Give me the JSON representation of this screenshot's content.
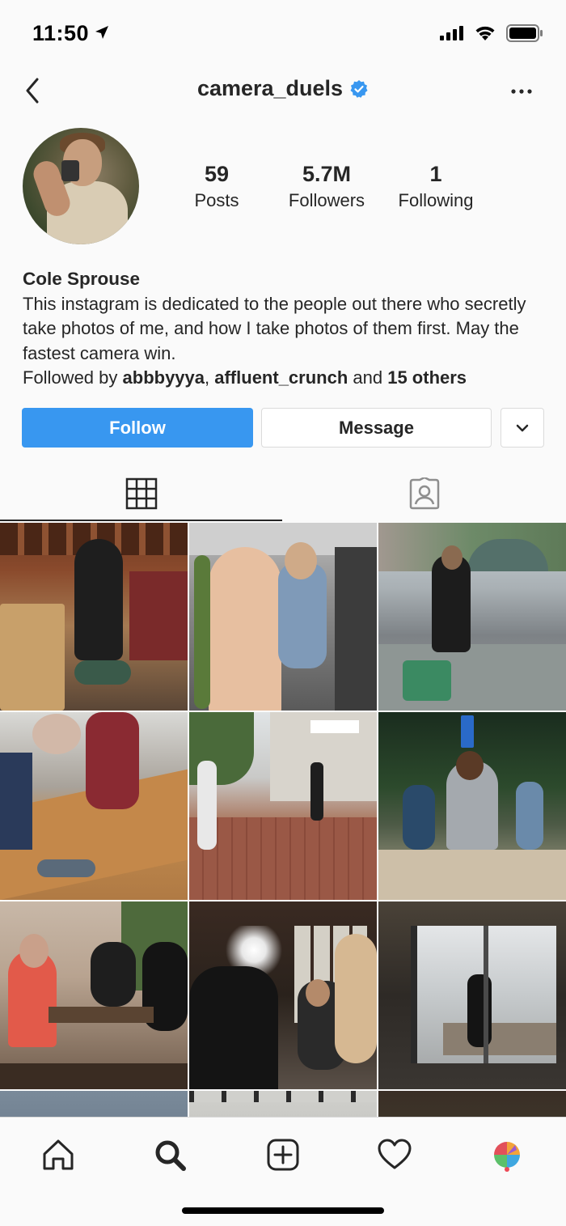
{
  "status_bar": {
    "time": "11:50"
  },
  "header": {
    "username": "camera_duels",
    "verified": true
  },
  "profile": {
    "stats": [
      {
        "value": "59",
        "label": "Posts"
      },
      {
        "value": "5.7M",
        "label": "Followers"
      },
      {
        "value": "1",
        "label": "Following"
      }
    ],
    "name": "Cole Sprouse",
    "bio": "This instagram is dedicated to the people out there who secretly take photos of me, and how I take photos of them first. May the fastest camera win.",
    "followed_by": {
      "prefix": "Followed by ",
      "user1": "abbbyyya",
      "sep": ", ",
      "user2": "affluent_crunch",
      "mid": " and ",
      "others": "15 others"
    }
  },
  "actions": {
    "follow_label": "Follow",
    "message_label": "Message"
  },
  "tabs": [
    {
      "icon": "grid-icon",
      "active": true
    },
    {
      "icon": "tagged-icon",
      "active": false
    }
  ],
  "colors": {
    "accent": "#3897f0",
    "verified": "#3897f0",
    "notification": "#ed4956"
  },
  "bottom_nav": [
    {
      "icon": "home-icon"
    },
    {
      "icon": "search-icon"
    },
    {
      "icon": "new-post-icon"
    },
    {
      "icon": "activity-heart-icon"
    },
    {
      "icon": "profile-icon"
    }
  ]
}
